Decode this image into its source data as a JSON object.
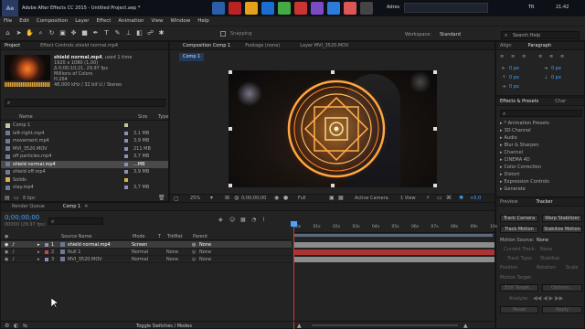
{
  "taskbar": {
    "window_title": "Adobe After Effects CC 2015 - Untitled Project.aep *",
    "address_label": "Adres",
    "lang": "TR",
    "time": "21:42"
  },
  "menu": [
    "File",
    "Edit",
    "Composition",
    "Layer",
    "Effect",
    "Animation",
    "View",
    "Window",
    "Help"
  ],
  "toolbar": {
    "snapping": "Snapping",
    "workspace_label": "Workspace:",
    "workspace_value": "Standard",
    "search_help": "Search Help"
  },
  "project_panel": {
    "tab_project": "Project",
    "tab_effect_controls": "Effect Controls shield normal.mp4",
    "selected": {
      "name": "shield normal.mp4",
      "used": ", used 1 time",
      "resolution": "1920 x 1080 (1,00)",
      "duration": "Δ 0;00;10;21, 29,97 fps",
      "colors": "Millions of Colors",
      "codec": "H.264",
      "audio": "48,000 kHz / 32 bit U / Stereo"
    },
    "col_name": "Name",
    "col_size": "Size",
    "col_type": "Type",
    "items": [
      {
        "name": "Comp 1",
        "size": "",
        "type": "",
        "color": "#c9c2a3",
        "kind": "comp"
      },
      {
        "name": "left-right.mp4",
        "size": "3,1 MB",
        "type": "",
        "color": "#8a8fb5",
        "kind": "file"
      },
      {
        "name": "movement.mp4",
        "size": "3,9 MB",
        "type": "",
        "color": "#8a8fb5",
        "kind": "file"
      },
      {
        "name": "MVI_3520.MOV",
        "size": "211 MB",
        "type": "",
        "color": "#8a8fb5",
        "kind": "file"
      },
      {
        "name": "off particles.mp4",
        "size": "3,7 MB",
        "type": "",
        "color": "#8a8fb5",
        "kind": "file"
      },
      {
        "name": "shield normal.mp4",
        "size": "...MB",
        "type": "",
        "color": "#8a8fb5",
        "kind": "file"
      },
      {
        "name": "shield off.mp4",
        "size": "3,9 MB",
        "type": "",
        "color": "#8a8fb5",
        "kind": "file"
      },
      {
        "name": "Solids",
        "size": "",
        "type": "",
        "color": "#d4b24a",
        "kind": "folder"
      },
      {
        "name": "stay.mp4",
        "size": "3,7 MB",
        "type": "",
        "color": "#8a8fb5",
        "kind": "file"
      }
    ],
    "bpc": "8 bpc"
  },
  "viewer": {
    "tab_composition": "Composition Comp 1",
    "tab_footage": "Footage (none)",
    "tab_layer": "Layer MVI_3520.MOV",
    "comp_tab": "Comp 1",
    "zoom": "25%",
    "timecode": "0;00;00;00",
    "resolution": "Full",
    "camera": "Active Camera",
    "views": "1 View",
    "exposure": "+0,0"
  },
  "right_panels": {
    "tab_align": "Align",
    "tab_paragraph": "Paragraph",
    "para_values": [
      "0 px",
      "0 px",
      "0 px",
      "0 px",
      "0 px"
    ],
    "tab_effects": "Effects & Presets",
    "tab_char": "Char",
    "effects_list": [
      "* Animation Presets",
      "3D Channel",
      "Audio",
      "Blur & Sharpen",
      "Channel",
      "CINEMA 4D",
      "Color Correction",
      "Distort",
      "Expression Controls",
      "Generate"
    ],
    "tab_preview": "Preview",
    "tab_tracker": "Tracker",
    "track_camera": "Track Camera",
    "warp_stabilizer": "Warp Stabilizer",
    "track_motion": "Track Motion",
    "stabilize_motion": "Stabilize Motion",
    "motion_source_label": "Motion Source:",
    "motion_source_value": "None",
    "current_track_label": "Current Track:",
    "current_track_value": "None",
    "track_type_label": "Track Type:",
    "track_type_value": "Stabilize",
    "position": "Position",
    "rotation": "Rotation",
    "scale": "Scale",
    "motion_target": "Motion Target:",
    "edit_target": "Edit Target...",
    "options": "Options...",
    "analyze": "Analyze:",
    "reset": "Reset",
    "apply": "Apply"
  },
  "timeline": {
    "tab_render": "Render Queue",
    "tab_comp": "Comp 1",
    "timecode": "0;00;00;00",
    "fps": "00000 (29.97 fps)",
    "col_source": "Source Name",
    "col_mode": "Mode",
    "col_t": "T",
    "col_trkmat": "TrkMat",
    "col_parent": "Parent",
    "layers": [
      {
        "num": "1",
        "name": "shield normal.mp4",
        "mode": "Screen",
        "trkmat": "",
        "parent": "None",
        "color": "#8a8fb5",
        "bar": "#8c8c8c",
        "selected": true
      },
      {
        "num": "2",
        "name": "Null 1",
        "mode": "Normal",
        "trkmat": "None",
        "parent": "None",
        "color": "#c44",
        "bar": "#a33",
        "selected": false
      },
      {
        "num": "3",
        "name": "MVI_3520.MOV",
        "mode": "Normal",
        "trkmat": "None",
        "parent": "None",
        "color": "#8a8fb5",
        "bar": "#8c8c8c",
        "selected": false
      }
    ],
    "ruler": [
      "00s",
      "01s",
      "02s",
      "03s",
      "04s",
      "05s",
      "06s",
      "07s",
      "08s",
      "09s",
      "10s"
    ],
    "toggle_label": "Toggle Switches / Modes"
  }
}
